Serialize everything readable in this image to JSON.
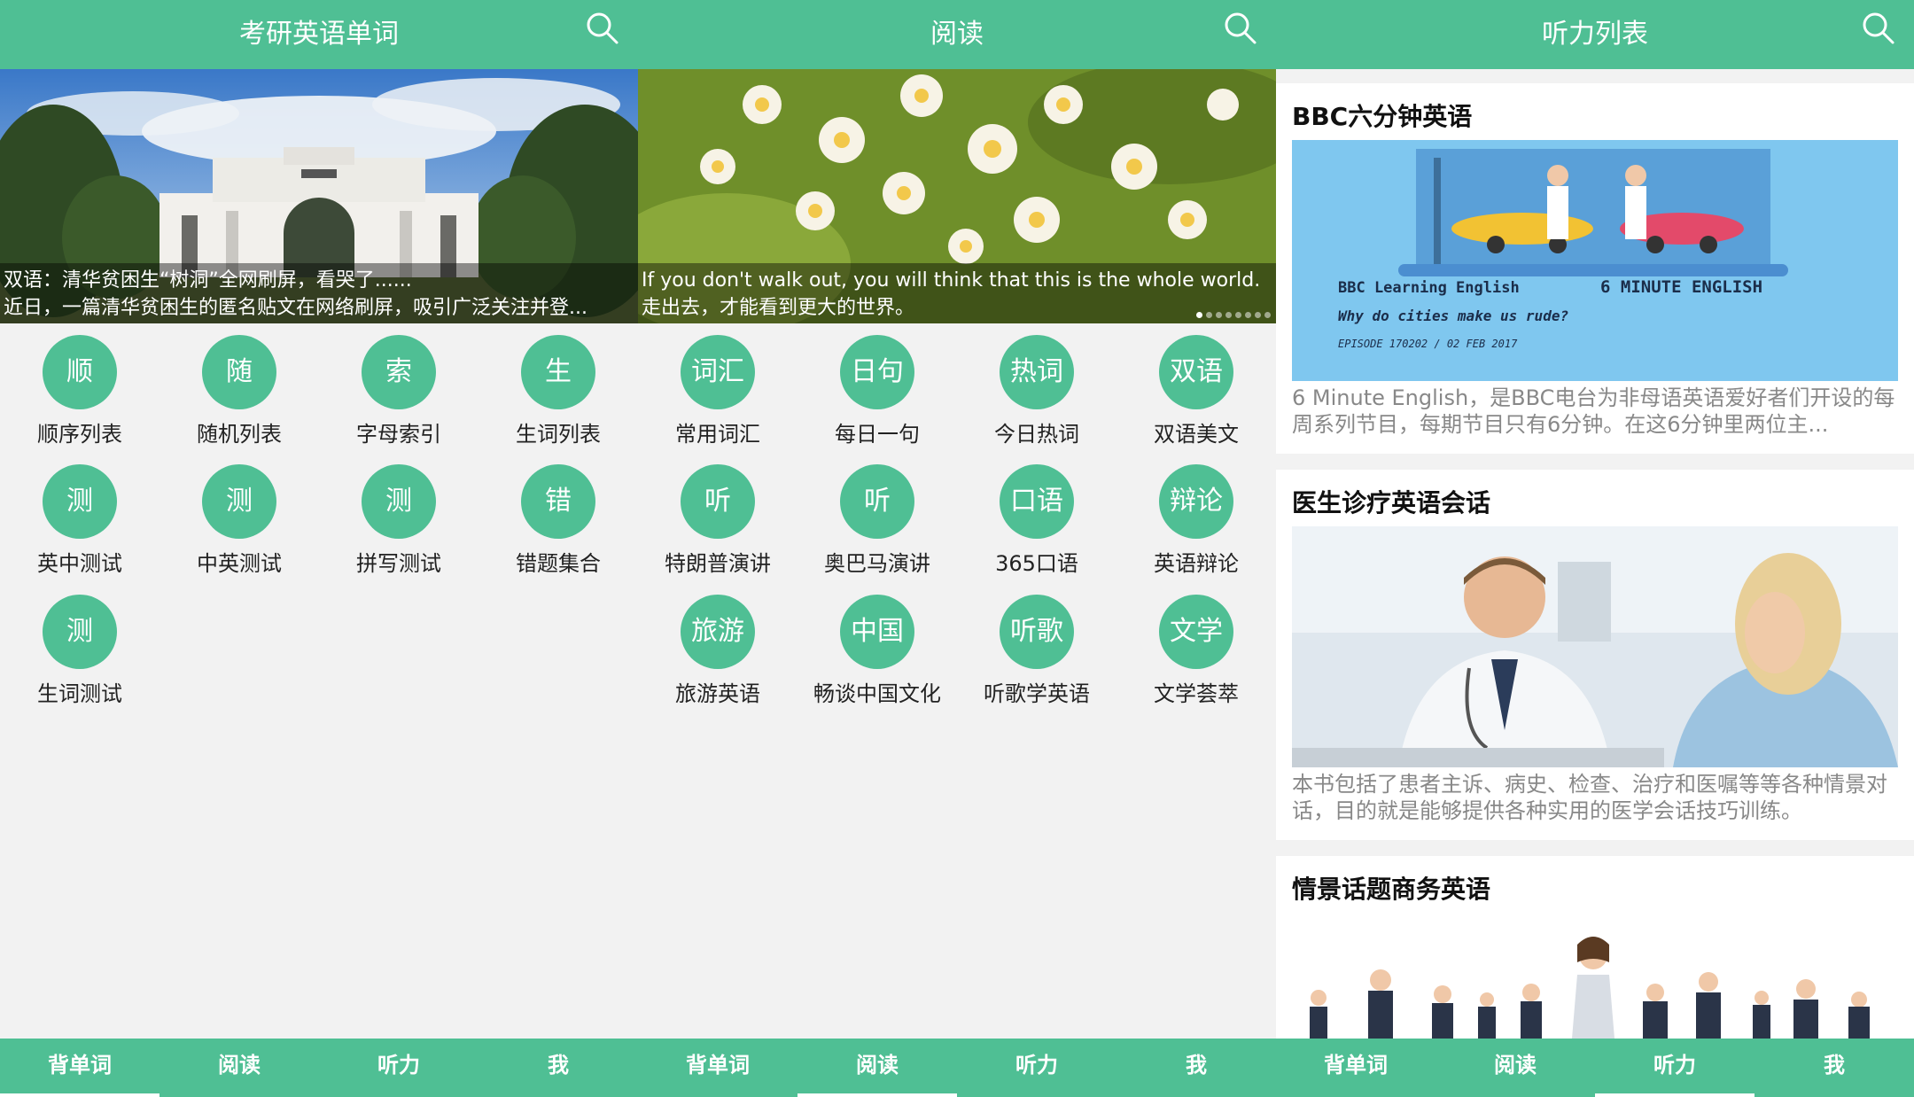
{
  "screens": {
    "words": {
      "title": "考研英语单词",
      "banner_caption_1": "双语：清华贫困生“树洞”全网刷屏，看哭了......",
      "banner_caption_2": "近日，一篇清华贫困生的匿名贴文在网络刷屏，吸引广泛关注并登...",
      "menu": [
        {
          "icon_text": "顺",
          "label": "顺序列表"
        },
        {
          "icon_text": "随",
          "label": "随机列表"
        },
        {
          "icon_text": "索",
          "label": "字母索引"
        },
        {
          "icon_text": "生",
          "label": "生词列表"
        },
        {
          "icon_text": "测",
          "label": "英中测试"
        },
        {
          "icon_text": "测",
          "label": "中英测试"
        },
        {
          "icon_text": "测",
          "label": "拼写测试"
        },
        {
          "icon_text": "错",
          "label": "错题集合"
        },
        {
          "icon_text": "测",
          "label": "生词测试"
        }
      ]
    },
    "reading": {
      "title": "阅读",
      "banner_caption_1": "If you don't walk out, you will think that this is the whole world.",
      "banner_caption_2": "走出去，才能看到更大的世界。",
      "menu": [
        {
          "icon_text": "词汇",
          "label": "常用词汇"
        },
        {
          "icon_text": "日句",
          "label": "每日一句"
        },
        {
          "icon_text": "热词",
          "label": "今日热词"
        },
        {
          "icon_text": "双语",
          "label": "双语美文"
        },
        {
          "icon_text": "听",
          "label": "特朗普演讲"
        },
        {
          "icon_text": "听",
          "label": "奥巴马演讲"
        },
        {
          "icon_text": "口语",
          "label": "365口语"
        },
        {
          "icon_text": "辩论",
          "label": "英语辩论"
        },
        {
          "icon_text": "旅游",
          "label": "旅游英语"
        },
        {
          "icon_text": "中国",
          "label": "畅谈中国文化"
        },
        {
          "icon_text": "听歌",
          "label": "听歌学英语"
        },
        {
          "icon_text": "文学",
          "label": "文学荟萃"
        }
      ]
    },
    "listening": {
      "title": "听力列表",
      "cards": [
        {
          "title": "BBC六分钟英语",
          "image_line1": "BBC Learning English",
          "image_line1b": "6 MINUTE ENGLISH",
          "image_line2": "Why do cities make us rude?",
          "image_line3": "EPISODE 170202 / 02 FEB 2017",
          "desc": "6 Minute English，是BBC电台为非母语英语爱好者们开设的每周系列节目，每期节目只有6分钟。在这6分钟里两位主..."
        },
        {
          "title": "医生诊疗英语会话",
          "desc": "本书包括了患者主诉、病史、检查、治疗和医嘱等等各种情景对话，目的就是能够提供各种实用的医学会话技巧训练。"
        },
        {
          "title": "情景话题商务英语"
        }
      ]
    }
  },
  "tabs": [
    "背单词",
    "阅读",
    "听力",
    "我"
  ],
  "colors": {
    "accent": "#4fbf94",
    "background": "#f2f2f2"
  }
}
